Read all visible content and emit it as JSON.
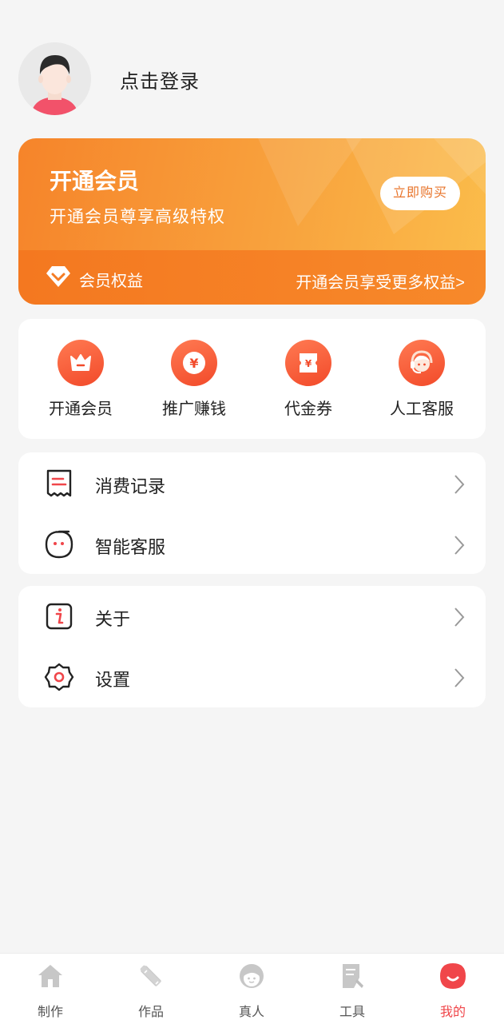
{
  "header": {
    "login_text": "点击登录"
  },
  "vip": {
    "title": "开通会员",
    "subtitle": "开通会员尊享高级特权",
    "buy_label": "立即购买",
    "rights_label": "会员权益",
    "more_label": "开通会员享受更多权益>"
  },
  "quick": [
    {
      "label": "开通会员",
      "icon": "crown-icon"
    },
    {
      "label": "推广赚钱",
      "icon": "yen-coin-icon"
    },
    {
      "label": "代金券",
      "icon": "voucher-icon"
    },
    {
      "label": "人工客服",
      "icon": "customer-service-icon"
    }
  ],
  "list1": [
    {
      "label": "消费记录",
      "icon": "receipt-icon"
    },
    {
      "label": "智能客服",
      "icon": "chat-bubble-icon"
    }
  ],
  "list2": [
    {
      "label": "关于",
      "icon": "info-icon"
    },
    {
      "label": "设置",
      "icon": "settings-gear-icon"
    }
  ],
  "nav": [
    {
      "label": "制作",
      "icon": "home-icon",
      "active": false
    },
    {
      "label": "作品",
      "icon": "pencil-ruler-icon",
      "active": false
    },
    {
      "label": "真人",
      "icon": "person-icon",
      "active": false
    },
    {
      "label": "工具",
      "icon": "tools-icon",
      "active": false
    },
    {
      "label": "我的",
      "icon": "profile-smile-icon",
      "active": true
    }
  ],
  "colors": {
    "accent": "#f0464a",
    "vip_orange": "#f6842a",
    "icon_red": "#f24a2a"
  }
}
